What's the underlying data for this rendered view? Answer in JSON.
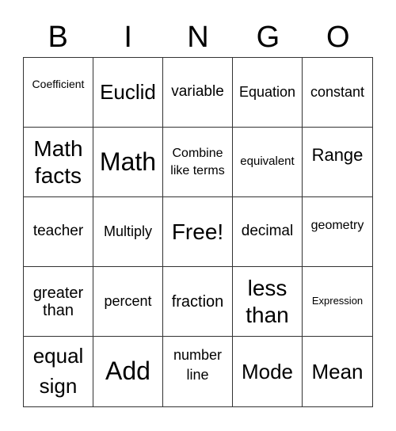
{
  "header": {
    "letters": [
      "B",
      "I",
      "N",
      "G",
      "O"
    ]
  },
  "cells": [
    [
      "Coefficient",
      "Euclid",
      "variable",
      "Equation",
      "constant"
    ],
    [
      "Math facts",
      "Math",
      "Combine like terms",
      "equivalent",
      "Range"
    ],
    [
      "teacher",
      "Multiply",
      "Free!",
      "decimal",
      "geometry"
    ],
    [
      "greater than",
      "percent",
      "fraction",
      "less than",
      "Expression"
    ],
    [
      "equal sign",
      "Add",
      "number line",
      "Mode",
      "Mean"
    ]
  ]
}
